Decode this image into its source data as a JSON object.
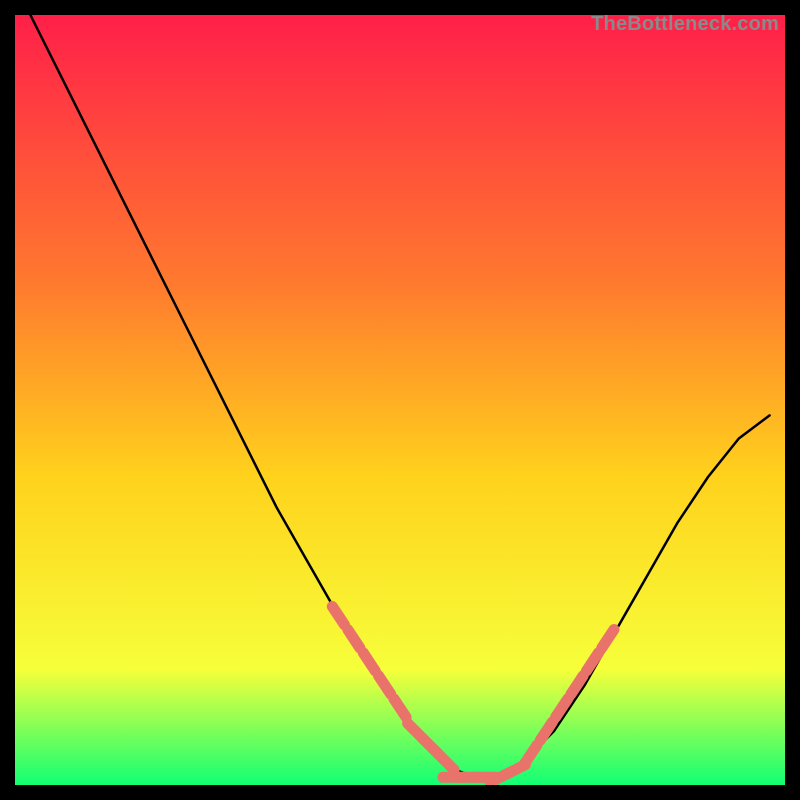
{
  "watermark": "TheBottleneck.com",
  "colors": {
    "gradient_top": "#ff1f49",
    "gradient_mid_upper": "#ff7a2e",
    "gradient_mid": "#ffd21c",
    "gradient_lower": "#f6ff3a",
    "gradient_bottom": "#11ff74",
    "curve": "#000000",
    "marker": "#e9736b",
    "frame_bg": "#000000"
  },
  "chart_data": {
    "type": "line",
    "title": "",
    "xlabel": "",
    "ylabel": "",
    "xlim": [
      0,
      100
    ],
    "ylim": [
      0,
      100
    ],
    "grid": false,
    "legend": false,
    "series": [
      {
        "name": "bottleneck-curve",
        "x": [
          2,
          6,
          10,
          14,
          18,
          22,
          26,
          30,
          34,
          38,
          42,
          46,
          50,
          54,
          57,
          60,
          63,
          66,
          70,
          74,
          78,
          82,
          86,
          90,
          94,
          98
        ],
        "y": [
          100,
          92,
          84,
          76,
          68,
          60,
          52,
          44,
          36,
          29,
          22,
          16,
          10,
          5,
          2,
          1,
          1,
          3,
          7,
          13,
          20,
          27,
          34,
          40,
          45,
          48
        ]
      },
      {
        "name": "highlighted-range-left",
        "x": [
          42,
          44,
          46,
          48,
          50,
          52,
          54,
          56
        ],
        "y": [
          22,
          19,
          16,
          13,
          10,
          7,
          5,
          3
        ]
      },
      {
        "name": "highlighted-range-bottom",
        "x": [
          57,
          59,
          61,
          63,
          65
        ],
        "y": [
          1,
          1,
          1,
          1,
          2
        ]
      },
      {
        "name": "highlighted-range-right",
        "x": [
          67,
          69,
          71,
          73,
          75,
          77
        ],
        "y": [
          4,
          7,
          10,
          13,
          16,
          19
        ]
      }
    ]
  }
}
